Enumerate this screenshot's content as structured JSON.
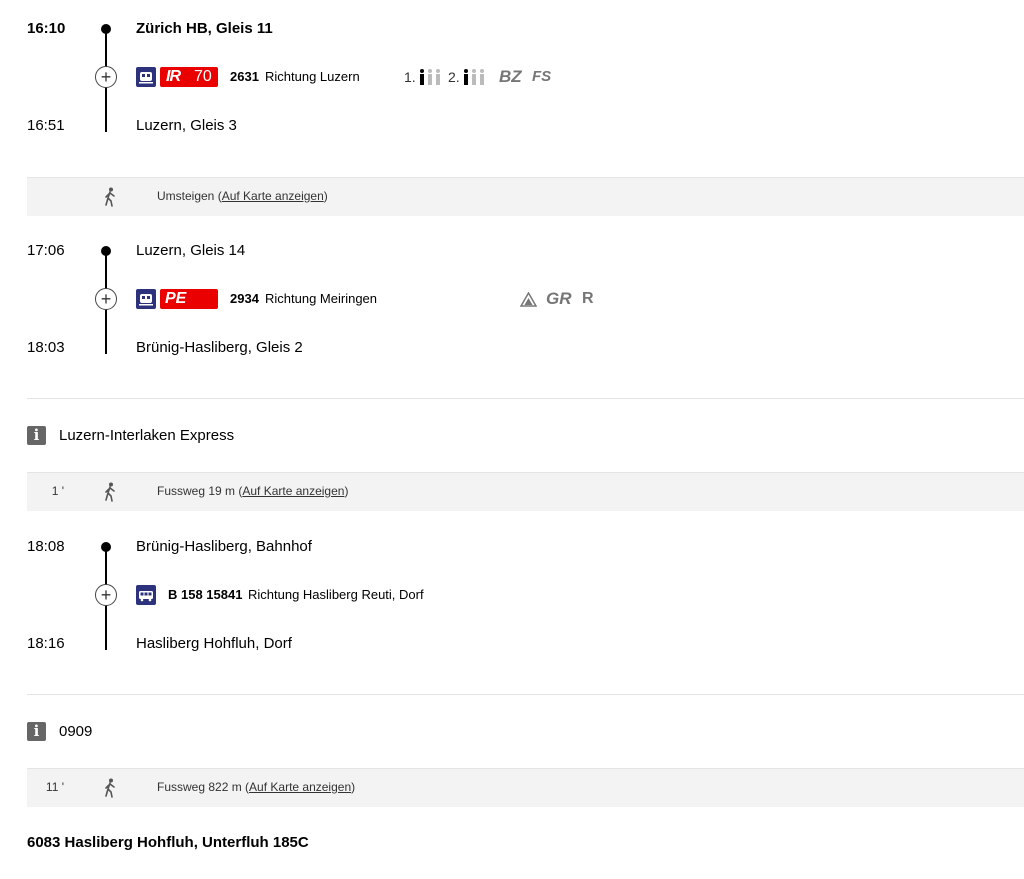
{
  "legs": [
    {
      "dep_time": "16:10",
      "dep_stop": "Zürich HB, Gleis 11",
      "train_label": "IR",
      "train_line": "70",
      "train_number": "2631",
      "direction": "Richtung Luzern",
      "class1": "1.",
      "class2": "2.",
      "attr1": "BZ",
      "attr2": "FS",
      "arr_time": "16:51",
      "arr_stop": "Luzern, Gleis 3"
    },
    {
      "dep_time": "17:06",
      "dep_stop": "Luzern, Gleis 14",
      "train_label": "PE",
      "train_number": "2934",
      "direction": "Richtung Meiringen",
      "attr1": "GR",
      "attr2": "R",
      "arr_time": "18:03",
      "arr_stop": "Brünig-Hasliberg, Gleis 2"
    },
    {
      "dep_time": "18:08",
      "dep_stop": "Brünig-Hasliberg, Bahnhof",
      "train_number": "B 158 15841",
      "direction": "Richtung Hasliberg Reuti, Dorf",
      "arr_time": "18:16",
      "arr_stop": "Hasliberg Hohfluh, Dorf"
    }
  ],
  "transfers": [
    {
      "duration": "",
      "text": "Umsteigen (",
      "link": "Auf Karte anzeigen",
      "close": ")"
    },
    {
      "duration": "1 '",
      "text": "Fussweg 19 m (",
      "link": "Auf Karte anzeigen",
      "close": ")"
    },
    {
      "duration": "11 '",
      "text": "Fussweg 822 m (",
      "link": "Auf Karte anzeigen",
      "close": ")"
    }
  ],
  "infos": [
    {
      "text": "Luzern-Interlaken Express"
    },
    {
      "text": "0909"
    }
  ],
  "destination": "6083 Hasliberg Hohfluh, Unterfluh 185C",
  "colors": {
    "sbb_red": "#eb0000",
    "sbb_blue": "#2d327d",
    "gray_bar": "#f3f3f3"
  }
}
